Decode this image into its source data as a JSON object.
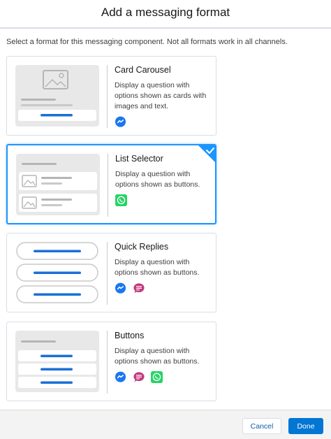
{
  "modal": {
    "title": "Add a messaging format"
  },
  "intro": "Select a format for this messaging component. Not all formats work in all channels.",
  "colors": {
    "accent": "#0176d3",
    "selected_border": "#1b96ff",
    "messenger": "#1877f2",
    "sms": "#c23a7e",
    "whatsapp": "#25d366"
  },
  "formats": [
    {
      "title": "Card Carousel",
      "desc_lines": [
        "Display a question with",
        "options shown as cards with",
        "images and text."
      ],
      "channels": [
        "messenger-icon"
      ],
      "selected": false
    },
    {
      "title": "List Selector",
      "desc_lines": [
        "Display a question with",
        "options shown as buttons."
      ],
      "channels": [
        "whatsapp-icon"
      ],
      "selected": true
    },
    {
      "title": "Quick Replies",
      "desc_lines": [
        "Display a question with",
        "options shown as buttons."
      ],
      "channels": [
        "messenger-icon",
        "sms-icon"
      ],
      "selected": false
    },
    {
      "title": "Buttons",
      "desc_lines": [
        "Display a question with",
        "options shown as buttons."
      ],
      "channels": [
        "messenger-icon",
        "sms-icon",
        "whatsapp-icon"
      ],
      "selected": false
    }
  ],
  "footer": {
    "cancel_label": "Cancel",
    "done_label": "Done"
  }
}
